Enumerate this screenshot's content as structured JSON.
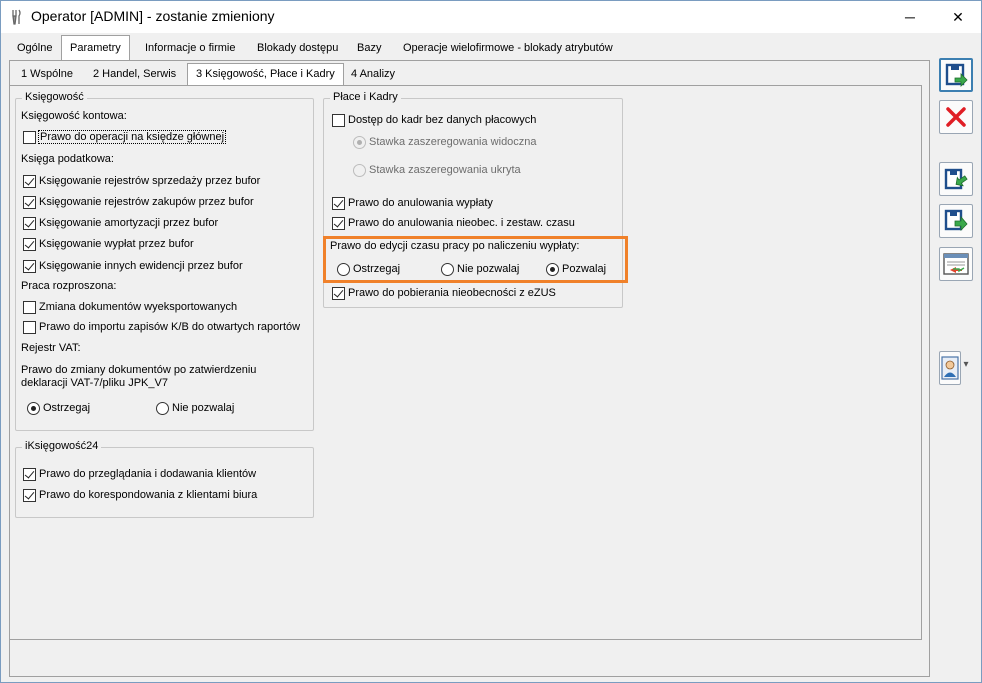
{
  "window": {
    "title": "Operator [ADMIN] - zostanie zmieniony",
    "minimize_glyph": "─",
    "close_glyph": "✕"
  },
  "tabs_top": [
    {
      "label": "Ogólne",
      "active": false
    },
    {
      "label": "Parametry",
      "active": true
    },
    {
      "label": "Informacje o firmie",
      "active": false
    },
    {
      "label": "Blokady dostępu",
      "active": false
    },
    {
      "label": "Bazy",
      "active": false
    },
    {
      "label": "Operacje wielofirmowe - blokady atrybutów",
      "active": false
    }
  ],
  "tabs_sub": [
    {
      "label": "1 Wspólne",
      "active": false
    },
    {
      "label": "2 Handel, Serwis",
      "active": false
    },
    {
      "label": "3 Księgowość, Płace i Kadry",
      "active": true
    },
    {
      "label": "4 Analizy",
      "active": false
    }
  ],
  "ksiegowosc": {
    "legend": "Księgowość",
    "kontowa_label": "Księgowość kontowa:",
    "operacje_ksiega": {
      "label": "Prawo do operacji na księdze głównej",
      "checked": false
    },
    "podatkowa_label": "Księga podatkowa:",
    "podatkowa_items": [
      {
        "label": "Księgowanie rejestrów sprzedaży przez bufor",
        "checked": true
      },
      {
        "label": "Księgowanie rejestrów zakupów przez bufor",
        "checked": true
      },
      {
        "label": "Księgowanie amortyzacji przez bufor",
        "checked": true
      },
      {
        "label": "Księgowanie wypłat przez bufor",
        "checked": true
      },
      {
        "label": "Księgowanie innych ewidencji przez bufor",
        "checked": true
      }
    ],
    "rozproszona_label": "Praca rozproszona:",
    "rozproszona_items": [
      {
        "label": "Zmiana dokumentów wyeksportowanych",
        "checked": false
      },
      {
        "label": "Prawo do importu zapisów K/B do otwartych raportów",
        "checked": false
      }
    ],
    "vat_label": "Rejestr VAT:",
    "vat_desc_line1": "Prawo do zmiany dokumentów po zatwierdzeniu",
    "vat_desc_line2": "deklaracji VAT-7/pliku JPK_V7",
    "vat_options": [
      {
        "label": "Ostrzegaj",
        "selected": true
      },
      {
        "label": "Nie pozwalaj",
        "selected": false
      }
    ]
  },
  "iksiegowosc": {
    "legend": "iKsięgowość24",
    "items": [
      {
        "label": "Prawo do przeglądania i dodawania klientów",
        "checked": true
      },
      {
        "label": "Prawo do korespondowania z klientami biura",
        "checked": true
      }
    ]
  },
  "place": {
    "legend": "Płace i Kadry",
    "dostep": {
      "label": "Dostęp do kadr bez danych płacowych",
      "checked": false
    },
    "stawka_options": [
      {
        "label": "Stawka zaszeregowania widoczna",
        "selected": true
      },
      {
        "label": "Stawka zaszeregowania ukryta",
        "selected": false
      }
    ],
    "anulowanie_wyplaty": {
      "label": "Prawo do anulowania wypłaty",
      "checked": true
    },
    "anulowanie_nieobec": {
      "label": "Prawo do anulowania nieobec. i zestaw. czasu",
      "checked": true
    },
    "edycja_label": "Prawo do edycji czasu pracy po naliczeniu wypłaty:",
    "edycja_options": [
      {
        "label": "Ostrzegaj",
        "selected": false
      },
      {
        "label": "Nie pozwalaj",
        "selected": false
      },
      {
        "label": "Pozwalaj",
        "selected": true
      }
    ],
    "pobieranie": {
      "label": "Prawo do pobierania nieobecności z eZUS",
      "checked": true
    }
  },
  "highlight_color": "#f0812a",
  "side_toolbar": [
    {
      "name": "save-icon"
    },
    {
      "name": "cancel-icon"
    },
    {
      "name": "save-next-icon"
    },
    {
      "name": "save-copy-icon"
    },
    {
      "name": "export-icon"
    },
    {
      "name": "user-menu-icon",
      "dropdown_glyph": "▾"
    }
  ]
}
